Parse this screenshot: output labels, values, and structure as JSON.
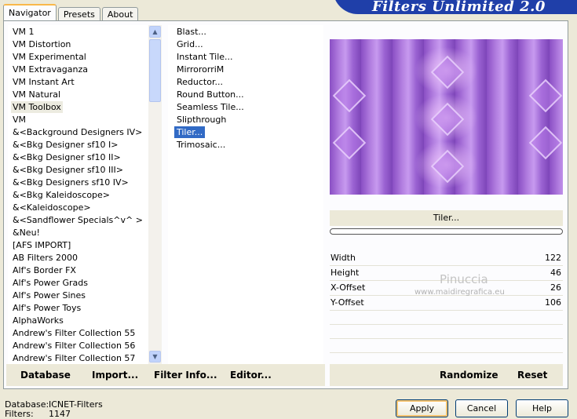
{
  "window": {
    "banner_title": "Filters Unlimited 2.0"
  },
  "tabs": [
    {
      "label": "Navigator",
      "active": true
    },
    {
      "label": "Presets",
      "active": false
    },
    {
      "label": "About",
      "active": false
    }
  ],
  "categories": [
    "VM 1",
    "VM Distortion",
    "VM Experimental",
    "VM Extravaganza",
    "VM Instant Art",
    "VM Natural",
    "VM Toolbox",
    "VM",
    "&<Background Designers IV>",
    "&<Bkg Designer sf10 I>",
    "&<Bkg Designer sf10 II>",
    "&<Bkg Designer sf10 III>",
    "&<Bkg Designers sf10 IV>",
    "&<Bkg Kaleidoscope>",
    "&<Kaleidoscope>",
    "&<Sandflower Specials^v^ >",
    "&Neu!",
    "[AFS IMPORT]",
    "AB Filters 2000",
    "Alf's Border FX",
    "Alf's Power Grads",
    "Alf's Power Sines",
    "Alf's Power Toys",
    "AlphaWorks",
    "Andrew's Filter Collection 55",
    "Andrew's Filter Collection 56",
    "Andrew's Filter Collection 57"
  ],
  "selected_category": "VM Toolbox",
  "filters": [
    "Blast...",
    "Grid...",
    "Instant Tile...",
    "MirrororriM",
    "Reductor...",
    "Round Button...",
    "Seamless Tile...",
    "Slipthrough",
    "Tiler...",
    "Trimosaic..."
  ],
  "selected_filter": "Tiler...",
  "preview": {
    "filter_name": "Tiler...",
    "progress": 0
  },
  "params": [
    {
      "name": "Width",
      "value": "122"
    },
    {
      "name": "Height",
      "value": "46"
    },
    {
      "name": "X-Offset",
      "value": "26"
    },
    {
      "name": "Y-Offset",
      "value": "106"
    }
  ],
  "watermark": {
    "name": "Pinuccia",
    "site": "www.maidiregrafica.eu"
  },
  "bottom_links": {
    "database": "Database",
    "import": "Import...",
    "filter_info": "Filter Info...",
    "editor": "Editor..."
  },
  "right_links": {
    "randomize": "Randomize",
    "reset": "Reset"
  },
  "status": {
    "database_label": "Database:",
    "database_value": "ICNET-Filters",
    "filters_label": "Filters:",
    "filters_value": "1147"
  },
  "buttons": {
    "apply": "Apply",
    "cancel": "Cancel",
    "help": "Help"
  },
  "colors": {
    "selection": "#316ac5",
    "banner": "#1f3fa9",
    "preview_purple": "#9b5fd0"
  }
}
